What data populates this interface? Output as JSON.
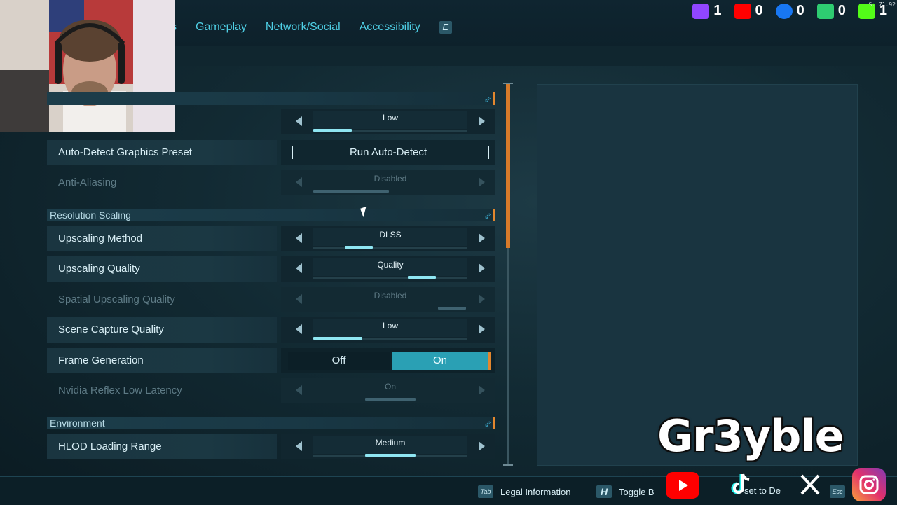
{
  "tabs": [
    "s",
    "Gameplay",
    "Network/Social",
    "Accessibility"
  ],
  "tab_key": "E",
  "counters": [
    {
      "icon": "twitch-icon",
      "value": "1",
      "color": "#9146ff"
    },
    {
      "icon": "youtube-icon",
      "value": "0",
      "color": "#ff0000"
    },
    {
      "icon": "facebook-icon",
      "value": "0",
      "color": "#1877f2"
    },
    {
      "icon": "puzzle-icon",
      "value": "0",
      "color": "#2ecc71"
    },
    {
      "icon": "kick-icon",
      "value": "1",
      "color": "#53fc18"
    }
  ],
  "fps_readout": "S: 71.92",
  "sections": {
    "resolution_scaling": "Resolution Scaling",
    "environment": "Environment"
  },
  "rows": {
    "preset": {
      "value": "Low",
      "progress": 0.25
    },
    "auto_detect": {
      "label": "Auto-Detect Graphics Preset",
      "button": "Run Auto-Detect"
    },
    "anti_aliasing": {
      "label": "Anti-Aliasing",
      "value": "Disabled",
      "progress": 1.0
    },
    "upscaling_method": {
      "label": "Upscaling Method",
      "value": "DLSS",
      "progress": 0.5
    },
    "upscaling_quality": {
      "label": "Upscaling Quality",
      "value": "Quality",
      "progress": 0.75
    },
    "spatial_upscaling": {
      "label": "Spatial Upscaling Quality",
      "value": "Disabled",
      "progress": 1.0
    },
    "scene_capture": {
      "label": "Scene Capture Quality",
      "value": "Low",
      "progress": 0.33
    },
    "frame_generation": {
      "label": "Frame Generation",
      "off": "Off",
      "on": "On"
    },
    "nvidia_reflex": {
      "label": "Nvidia Reflex Low Latency",
      "value": "On",
      "progress": 1.0
    },
    "hlod": {
      "label": "HLOD Loading Range",
      "value": "Medium",
      "progress": 0.66
    }
  },
  "bottom": {
    "tab_key": "Tab",
    "legal": "Legal Information",
    "h_key": "H",
    "toggle": "Toggle B",
    "reset": "set to De",
    "esc_key": "Esc"
  },
  "brand": "Gr3yble"
}
